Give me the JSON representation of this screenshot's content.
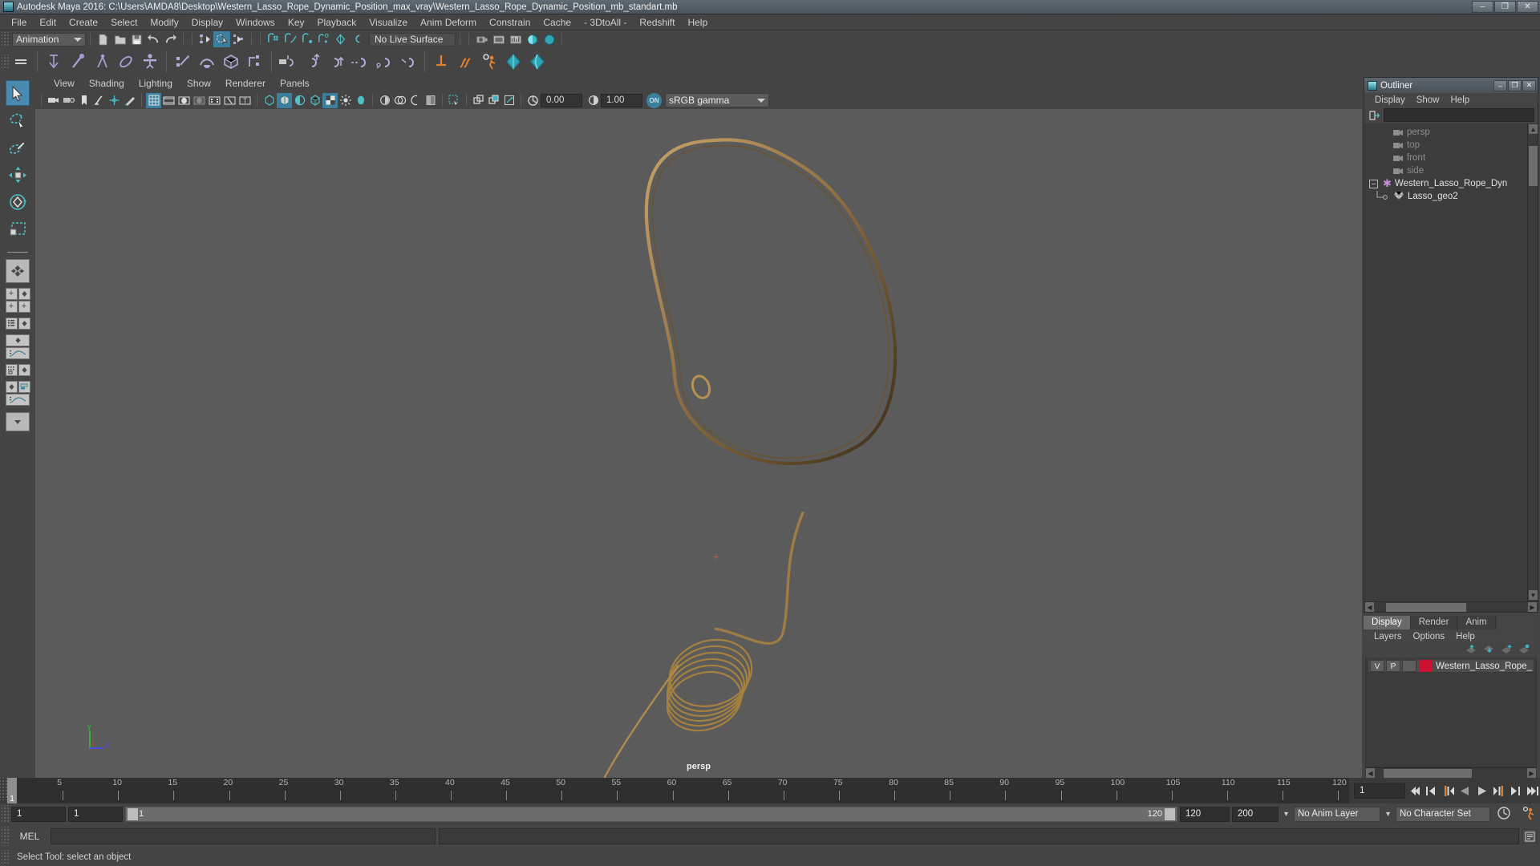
{
  "window": {
    "title": "Autodesk Maya 2016: C:\\Users\\AMDA8\\Desktop\\Western_Lasso_Rope_Dynamic_Position_max_vray\\Western_Lasso_Rope_Dynamic_Position_mb_standart.mb",
    "minimize": "–",
    "maximize": "❐",
    "close": "✕",
    "app_icon": "maya-icon"
  },
  "menubar": {
    "items": [
      "File",
      "Edit",
      "Create",
      "Select",
      "Modify",
      "Display",
      "Windows",
      "Key",
      "Playback",
      "Visualize",
      "Anim Deform",
      "Constrain",
      "Cache",
      "- 3DtoAll -",
      "Redshift",
      "Help"
    ]
  },
  "statusline": {
    "menuset": "Animation",
    "live_surface": "No Live Surface",
    "icons": [
      "new-scene-icon",
      "open-scene-icon",
      "save-scene-icon",
      "undo-icon",
      "redo-icon",
      "select-by-hierarchy-icon",
      "select-by-object-icon",
      "select-by-component-icon",
      "snap-to-grid-icon",
      "snap-to-curve-icon",
      "snap-to-point-icon",
      "snap-to-projected-center-icon",
      "snap-to-view-plane-icon",
      "make-live-icon",
      "render-current-frame-icon",
      "ipr-render-icon",
      "render-settings-icon",
      "hypershade-icon",
      "render-view-icon"
    ]
  },
  "shelf": {
    "icons": [
      "ik-handle-icon",
      "bone-icon",
      "joint-icon",
      "paint-weights-icon",
      "skin-icon",
      "keyframe-icon",
      "motion-path-icon",
      "deform-lattice-icon",
      "cluster-icon",
      "rope-a-icon",
      "rope-b-icon",
      "rope-c-icon",
      "rope-d-icon",
      "rope-e-icon",
      "rope-f-icon",
      "dynamics-icon",
      "hair-icon",
      "gear-person-icon",
      "fluid-icon",
      "nucleus-icon"
    ]
  },
  "toolbox": {
    "tools": [
      {
        "name": "select-tool",
        "selected": true
      },
      {
        "name": "lasso-select-tool",
        "selected": false
      },
      {
        "name": "paint-select-tool",
        "selected": false
      },
      {
        "name": "move-tool",
        "selected": false
      },
      {
        "name": "rotate-tool",
        "selected": false
      },
      {
        "name": "scale-tool",
        "selected": false
      }
    ],
    "layouts": [
      "single-perspective-layout",
      "four-view-layout",
      "outliner-persp-layout",
      "persp-graph-layout",
      "hypershade-persp-layout",
      "persp-graph-outliner-layout",
      "more-layouts"
    ]
  },
  "viewport": {
    "menus": [
      "View",
      "Shading",
      "Lighting",
      "Show",
      "Renderer",
      "Panels"
    ],
    "exposure": "0.00",
    "gamma": "1.00",
    "view_transform_enabled": "ON",
    "view_transform": "sRGB gamma",
    "camera_label": "persp",
    "axis": {
      "x": "x",
      "y": "y",
      "z": "z"
    },
    "toolbar_icons": [
      "select-camera-icon",
      "camera-attributes-icon",
      "bookmark-icon",
      "image-plane-icon",
      "two-d-pan-zoom-icon",
      "grease-pencil-icon",
      "grid-icon",
      "film-gate-icon",
      "resolution-gate-icon",
      "gate-mask-icon",
      "film-origin-icon",
      "safe-action-icon",
      "title-safe-icon",
      "wireframe-icon",
      "smooth-shade-icon",
      "shaded-wireframe-icon",
      "hardware-texturing-icon",
      "xray-icon",
      "lighting-icon",
      "shadows-icon",
      "screen-space-ao-icon",
      "motion-blur-icon",
      "multisample-icon",
      "depth-of-field-icon",
      "isolate-select-icon",
      "xray-joints-icon",
      "xray-active-icon",
      "exposure-icon",
      "gamma-icon"
    ]
  },
  "outliner": {
    "window_title": "Outliner",
    "menus": [
      "Display",
      "Show",
      "Help"
    ],
    "search_value": "",
    "items": [
      {
        "label": "persp",
        "icon": "camera-icon",
        "indent": 1,
        "dim": true
      },
      {
        "label": "top",
        "icon": "camera-icon",
        "indent": 1,
        "dim": true
      },
      {
        "label": "front",
        "icon": "camera-icon",
        "indent": 1,
        "dim": true
      },
      {
        "label": "side",
        "icon": "camera-icon",
        "indent": 1,
        "dim": true
      },
      {
        "label": "Western_Lasso_Rope_Dyn",
        "icon": "transform-star-icon",
        "indent": 0,
        "dim": false,
        "expander": "–"
      },
      {
        "label": "Lasso_geo2",
        "icon": "mesh-icon",
        "indent": 2,
        "dim": false
      }
    ]
  },
  "layer_editor": {
    "tabs": [
      {
        "label": "Display",
        "active": true
      },
      {
        "label": "Render",
        "active": false
      },
      {
        "label": "Anim",
        "active": false
      }
    ],
    "menus": [
      "Layers",
      "Options",
      "Help"
    ],
    "toolbar_icons": [
      "move-layer-up-icon",
      "move-layer-down-icon",
      "new-layer-icon",
      "new-layer-from-selected-icon"
    ],
    "layers": [
      {
        "visibility": "V",
        "playback": "P",
        "type": "",
        "color": "#cc1133",
        "name": "Western_Lasso_Rope_"
      }
    ]
  },
  "timeline": {
    "current_frame": "1",
    "ticks": [
      5,
      10,
      15,
      20,
      25,
      30,
      35,
      40,
      45,
      50,
      55,
      60,
      65,
      70,
      75,
      80,
      85,
      90,
      95,
      100,
      105,
      110,
      115,
      120
    ],
    "range_start": "1",
    "range_end": "120",
    "anim_start": "1",
    "anim_end": "120",
    "playback_end": "120",
    "total_end": "200",
    "frame_field": "1",
    "playback_buttons": [
      "go-to-start-icon",
      "step-back-frame-icon",
      "step-back-key-icon",
      "play-backwards-icon",
      "play-forwards-icon",
      "step-forward-key-icon",
      "step-forward-frame-icon",
      "go-to-end-icon"
    ],
    "anim_layer": "No Anim Layer",
    "character_set": "No Character Set",
    "auto_key_icon": "auto-keyframe-icon",
    "anim_prefs_icon": "animation-preferences-icon"
  },
  "command_line": {
    "language": "MEL",
    "input_value": "",
    "output_value": "",
    "script_editor_icon": "script-editor-icon"
  },
  "status_bar": {
    "message": "Select Tool: select an object"
  }
}
